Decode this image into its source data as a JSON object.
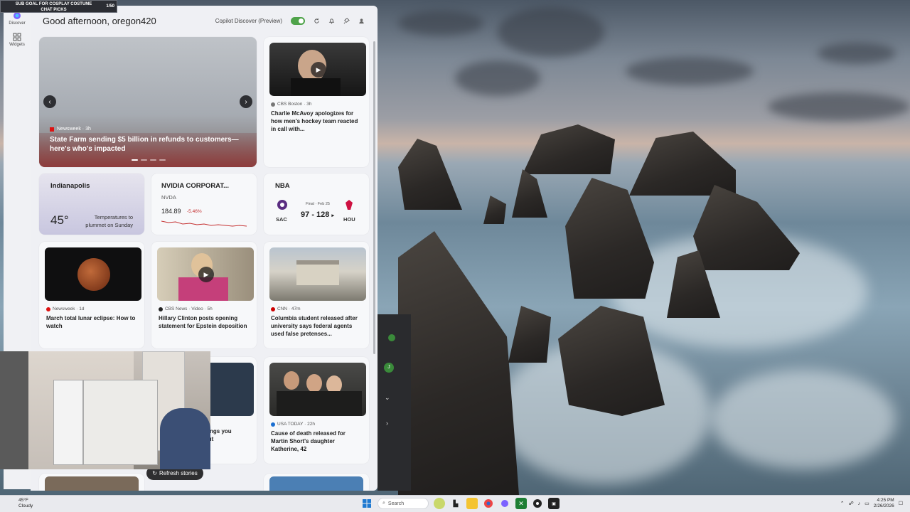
{
  "stream": {
    "banner": "SUB GOAL FOR COSPLAY COSTUME\nCHAT PICKS",
    "count": "1/50"
  },
  "rail": {
    "discover": "Discover",
    "widgets": "Widgets"
  },
  "header": {
    "greeting": "Good afternoon, oregon420",
    "copilot_label": "Copilot Discover (Preview)"
  },
  "hero": {
    "source": "Newsweek · 3h",
    "title": "State Farm sending $5 billion in refunds to customers—here's who's impacted"
  },
  "card_top_right": {
    "source": "CBS Boston · 3h",
    "title": "Charlie McAvoy apologizes for how men's hockey team reacted in call with..."
  },
  "weather": {
    "city": "Indianapolis",
    "temp": "45°",
    "desc": "Temperatures to plummet on Sunday"
  },
  "stock": {
    "name": "NVIDIA CORPORAT...",
    "ticker": "NVDA",
    "price": "184.89",
    "change": "-5.46%"
  },
  "nba": {
    "title": "NBA",
    "final": "Final · Feb 25",
    "away": "SAC",
    "home": "HOU",
    "away_score": "97",
    "home_score": "128"
  },
  "news": [
    {
      "source": "Newsweek · 1d",
      "title": "March total lunar eclipse: How to watch"
    },
    {
      "source": "CBS News · Video · 5h",
      "title": "Hillary Clinton posts opening statement for Epstein deposition"
    },
    {
      "source": "CNN · 47m",
      "title": "Columbia student released after university says federal agents used false pretenses..."
    },
    {
      "source": "USA TODAY · 22h",
      "title": "Cause of death released for Martin Short's daughter Katherine, 42"
    }
  ],
  "partial_card": {
    "title": "ettings you\nbout"
  },
  "refresh_label": "Refresh stories",
  "taskbar": {
    "weather_temp": "45°F",
    "weather_desc": "Cloudy",
    "search_placeholder": "Search",
    "time": "4:25 PM",
    "date": "2/26/2026"
  },
  "colors": {
    "accent": "#4fa34a",
    "negative": "#c53030"
  }
}
